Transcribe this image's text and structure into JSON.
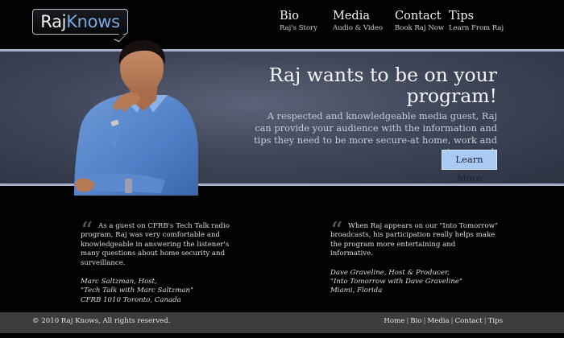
{
  "logo": {
    "part1": "Raj",
    "part2": "Knows"
  },
  "nav": [
    {
      "title": "Bio",
      "subtitle": "Raj's Story"
    },
    {
      "title": "Media",
      "subtitle": "Audio & Video"
    },
    {
      "title": "Contact",
      "subtitle": "Book Raj Now"
    },
    {
      "title": "Tips",
      "subtitle": "Learn From Raj"
    }
  ],
  "hero": {
    "title": "Raj wants to be on your program!",
    "text": "A respected and knowledgeable media guest, Raj can provide your audience with the information and tips they need to be more secure-at home, work and in general.",
    "button": "Learn More"
  },
  "testimonials": [
    {
      "quote": "As a guest on CFRB's Tech Talk radio program, Raj was very comfortable and knowledgeable in answering the listener's many questions about home security and surveillance.",
      "author": "Marc Saltzman, Host,",
      "show": "\"Tech Talk with Marc Saltzman\"",
      "location": "CFRB 1010 Toronto, Canada"
    },
    {
      "quote": "When Raj appears on our \"Into Tomorrow\" broadcasts, his participation really helps make the program more entertaining and informative.",
      "author": "Dave Graveline, Host & Producer,",
      "show": "\"Into Tomorrow with Dave Graveline\"",
      "location": "Miami, Florida"
    }
  ],
  "footer": {
    "copyright": "© 2010 Raj Knows, All rights reserved.",
    "links": [
      "Home",
      "Bio",
      "Media",
      "Contact",
      "Tips"
    ]
  },
  "colors": {
    "background": "#020203",
    "accent": "#7aa9de",
    "button": "#a9cbf3",
    "footer": "#3d3d3d"
  }
}
